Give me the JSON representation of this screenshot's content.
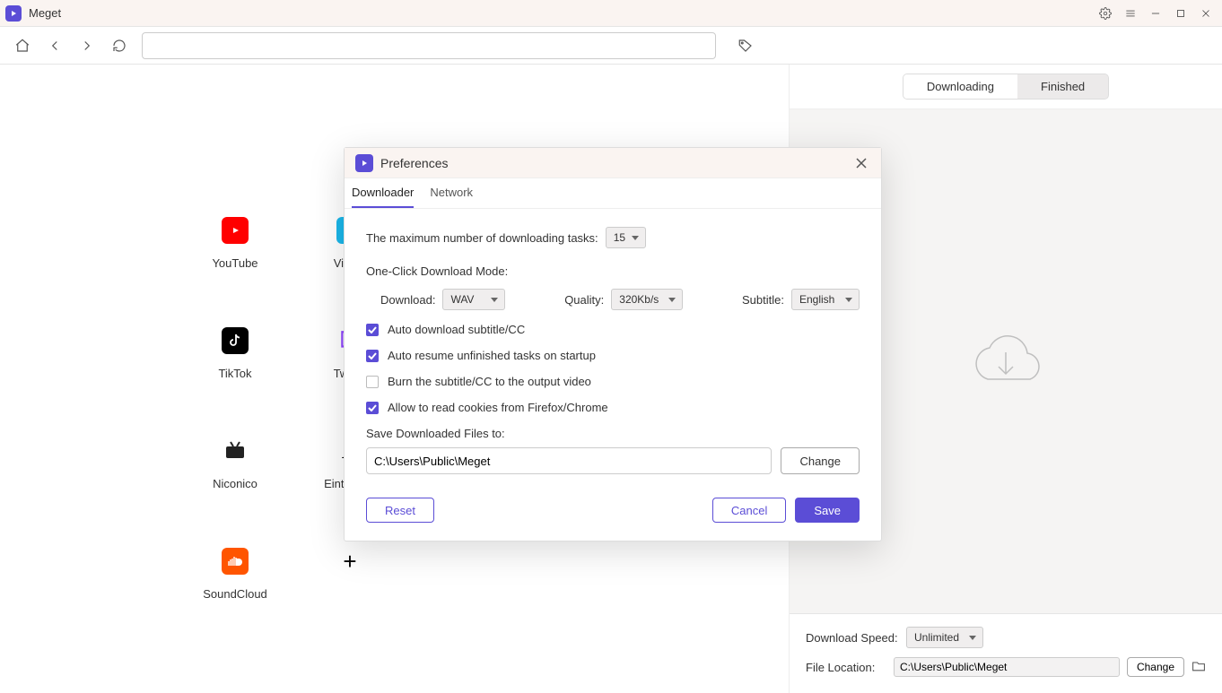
{
  "app": {
    "title": "Meget"
  },
  "toolbar": {
    "url_value": "",
    "url_placeholder": ""
  },
  "sites": [
    {
      "name": "YouTube",
      "bg": "#ff0000",
      "glyph": "yt"
    },
    {
      "name": "Vimeo",
      "bg": "#1ab7ea",
      "glyph": "V"
    },
    {
      "name": "TikTok",
      "bg": "#000000",
      "glyph": "tt"
    },
    {
      "name": "Twitch",
      "bg": "#ffffff",
      "glyph": "tw"
    },
    {
      "name": "Niconico",
      "bg": "#ffffff",
      "glyph": "ni"
    },
    {
      "name": "Einthusan",
      "bg": "#ffffff",
      "glyph": "E"
    },
    {
      "name": "SoundCloud",
      "bg": "#ff5500",
      "glyph": "sc"
    },
    {
      "name": "",
      "bg": "",
      "glyph": "+"
    }
  ],
  "right": {
    "tabs": {
      "downloading": "Downloading",
      "finished": "Finished"
    },
    "bottom": {
      "speed_label": "Download Speed:",
      "speed_value": "Unlimited",
      "location_label": "File Location:",
      "location_value": "C:\\Users\\Public\\Meget",
      "change_btn": "Change"
    }
  },
  "prefs": {
    "title": "Preferences",
    "tabs": {
      "downloader": "Downloader",
      "network": "Network"
    },
    "max_tasks_label": "The maximum number of downloading tasks:",
    "max_tasks_value": "15",
    "oneclick_heading": "One-Click Download Mode:",
    "download_label": "Download:",
    "download_value": "WAV",
    "quality_label": "Quality:",
    "quality_value": "320Kb/s",
    "subtitle_label": "Subtitle:",
    "subtitle_value": "English",
    "cb1": "Auto download subtitle/CC",
    "cb2": "Auto resume unfinished tasks on startup",
    "cb3": "Burn the subtitle/CC to the output video",
    "cb4": "Allow to read cookies from Firefox/Chrome",
    "save_to_label": "Save Downloaded Files to:",
    "save_to_value": "C:\\Users\\Public\\Meget",
    "change_btn": "Change",
    "reset_btn": "Reset",
    "cancel_btn": "Cancel",
    "save_btn": "Save"
  }
}
